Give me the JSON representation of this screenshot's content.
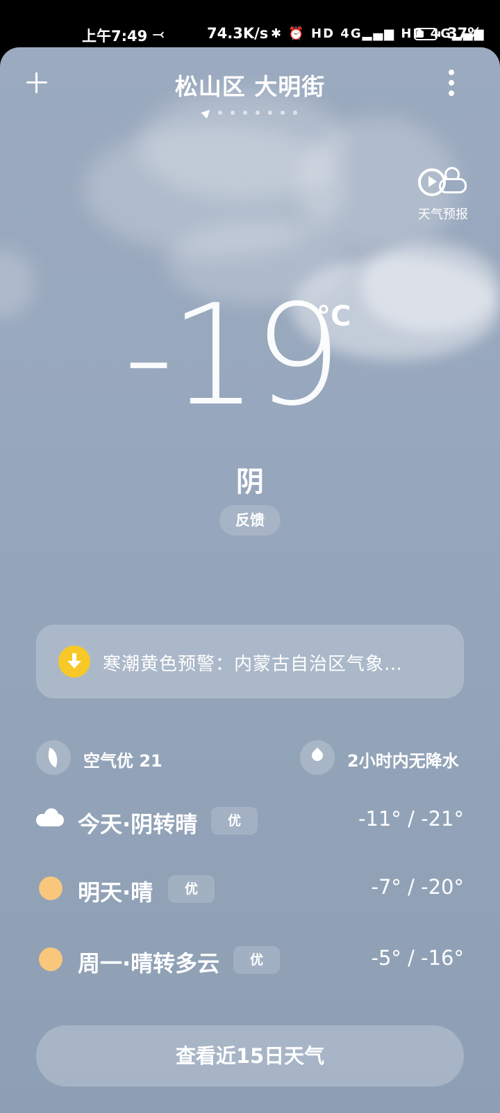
{
  "status_bar": {
    "time": "上午7:49",
    "misc_icon": "⤙",
    "net_speed": "74.3K/s",
    "icons_text": "✱ ⏰ HD 4G▂▄▆ HD 4G▂▄▆",
    "battery_level": 0.37,
    "battery_pct": "37%"
  },
  "header": {
    "location": "松山区 大明街",
    "add_icon": "plus-icon",
    "menu_icon": "more-vertical-icon"
  },
  "forecast_video": {
    "label": "天气预报",
    "icon": "play-weather-icon"
  },
  "current": {
    "temperature": "-19",
    "unit": "°C",
    "condition": "阴",
    "feedback_label": "反馈"
  },
  "alert": {
    "icon": "warning-download-icon",
    "color": "#f6c928",
    "text": "寒潮黄色预警：内蒙古自治区气象…"
  },
  "air_quality": {
    "icon": "leaf-icon",
    "text": "空气优 21"
  },
  "precipitation": {
    "icon": "drop-icon",
    "text": "2小时内无降水"
  },
  "days": [
    {
      "icon": "cloud-icon",
      "label": "今天·阴转晴",
      "aqi": "优",
      "temp": "-11° / -21°"
    },
    {
      "icon": "sun-icon",
      "label": "明天·晴",
      "aqi": "优",
      "temp": "-7° / -20°"
    },
    {
      "icon": "sun-icon",
      "label": "周一·晴转多云",
      "aqi": "优",
      "temp": "-5° / -16°"
    }
  ],
  "view_15_days_label": "查看近15日天气"
}
